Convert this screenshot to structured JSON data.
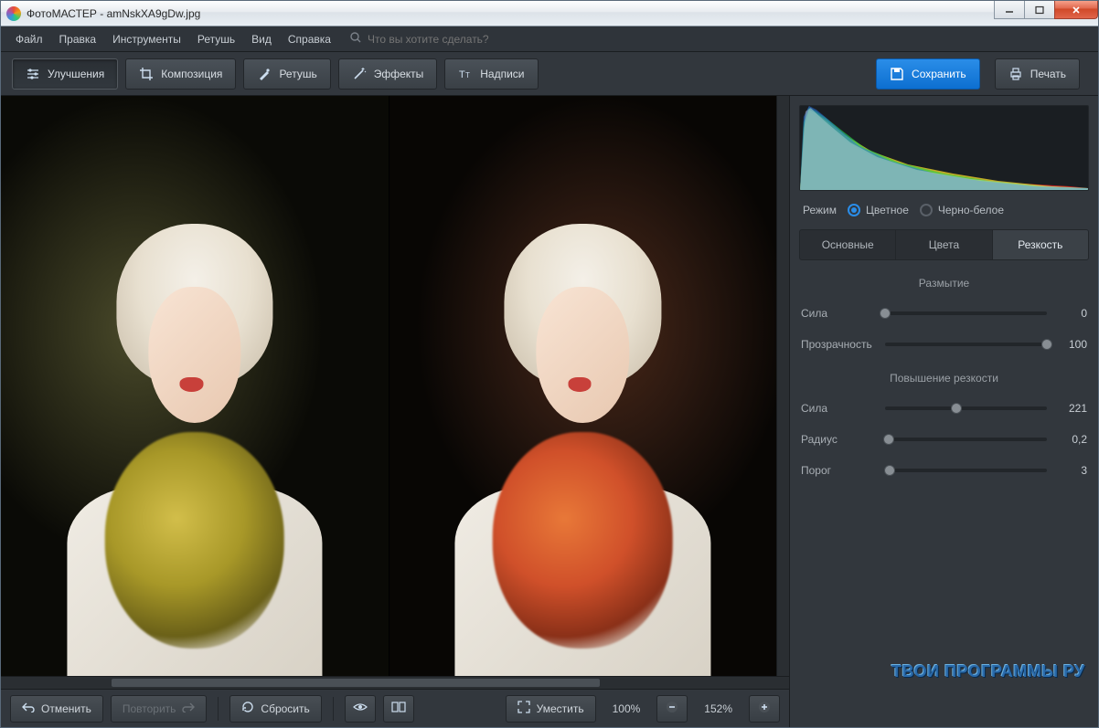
{
  "titlebar": {
    "app": "ФотоМАСТЕР",
    "file": "amNskXA9gDw.jpg"
  },
  "menu": {
    "file": "Файл",
    "edit": "Правка",
    "tools": "Инструменты",
    "retouch": "Ретушь",
    "view": "Вид",
    "help": "Справка",
    "search_placeholder": "Что вы хотите сделать?"
  },
  "toolbar": {
    "enhance": "Улучшения",
    "composition": "Композиция",
    "retouch": "Ретушь",
    "effects": "Эффекты",
    "captions": "Надписи",
    "save": "Сохранить",
    "print": "Печать"
  },
  "bottombar": {
    "undo": "Отменить",
    "redo": "Повторить",
    "reset": "Сбросить",
    "fit": "Уместить",
    "zoom_base": "100%",
    "zoom_current": "152%"
  },
  "sidepanel": {
    "mode_label": "Режим",
    "mode_color": "Цветное",
    "mode_bw": "Черно-белое",
    "tabs": {
      "basic": "Основные",
      "colors": "Цвета",
      "sharpness": "Резкость"
    },
    "section_blur": "Размытие",
    "section_sharp": "Повышение резкости",
    "sliders": {
      "strength1": {
        "label": "Сила",
        "value": "0",
        "pos": 0
      },
      "opacity": {
        "label": "Прозрачность",
        "value": "100",
        "pos": 100
      },
      "strength2": {
        "label": "Сила",
        "value": "221",
        "pos": 44
      },
      "radius": {
        "label": "Радиус",
        "value": "0,2",
        "pos": 2
      },
      "threshold": {
        "label": "Порог",
        "value": "3",
        "pos": 3
      }
    }
  },
  "watermark": "ТВОИ ПРОГРАММЫ РУ"
}
